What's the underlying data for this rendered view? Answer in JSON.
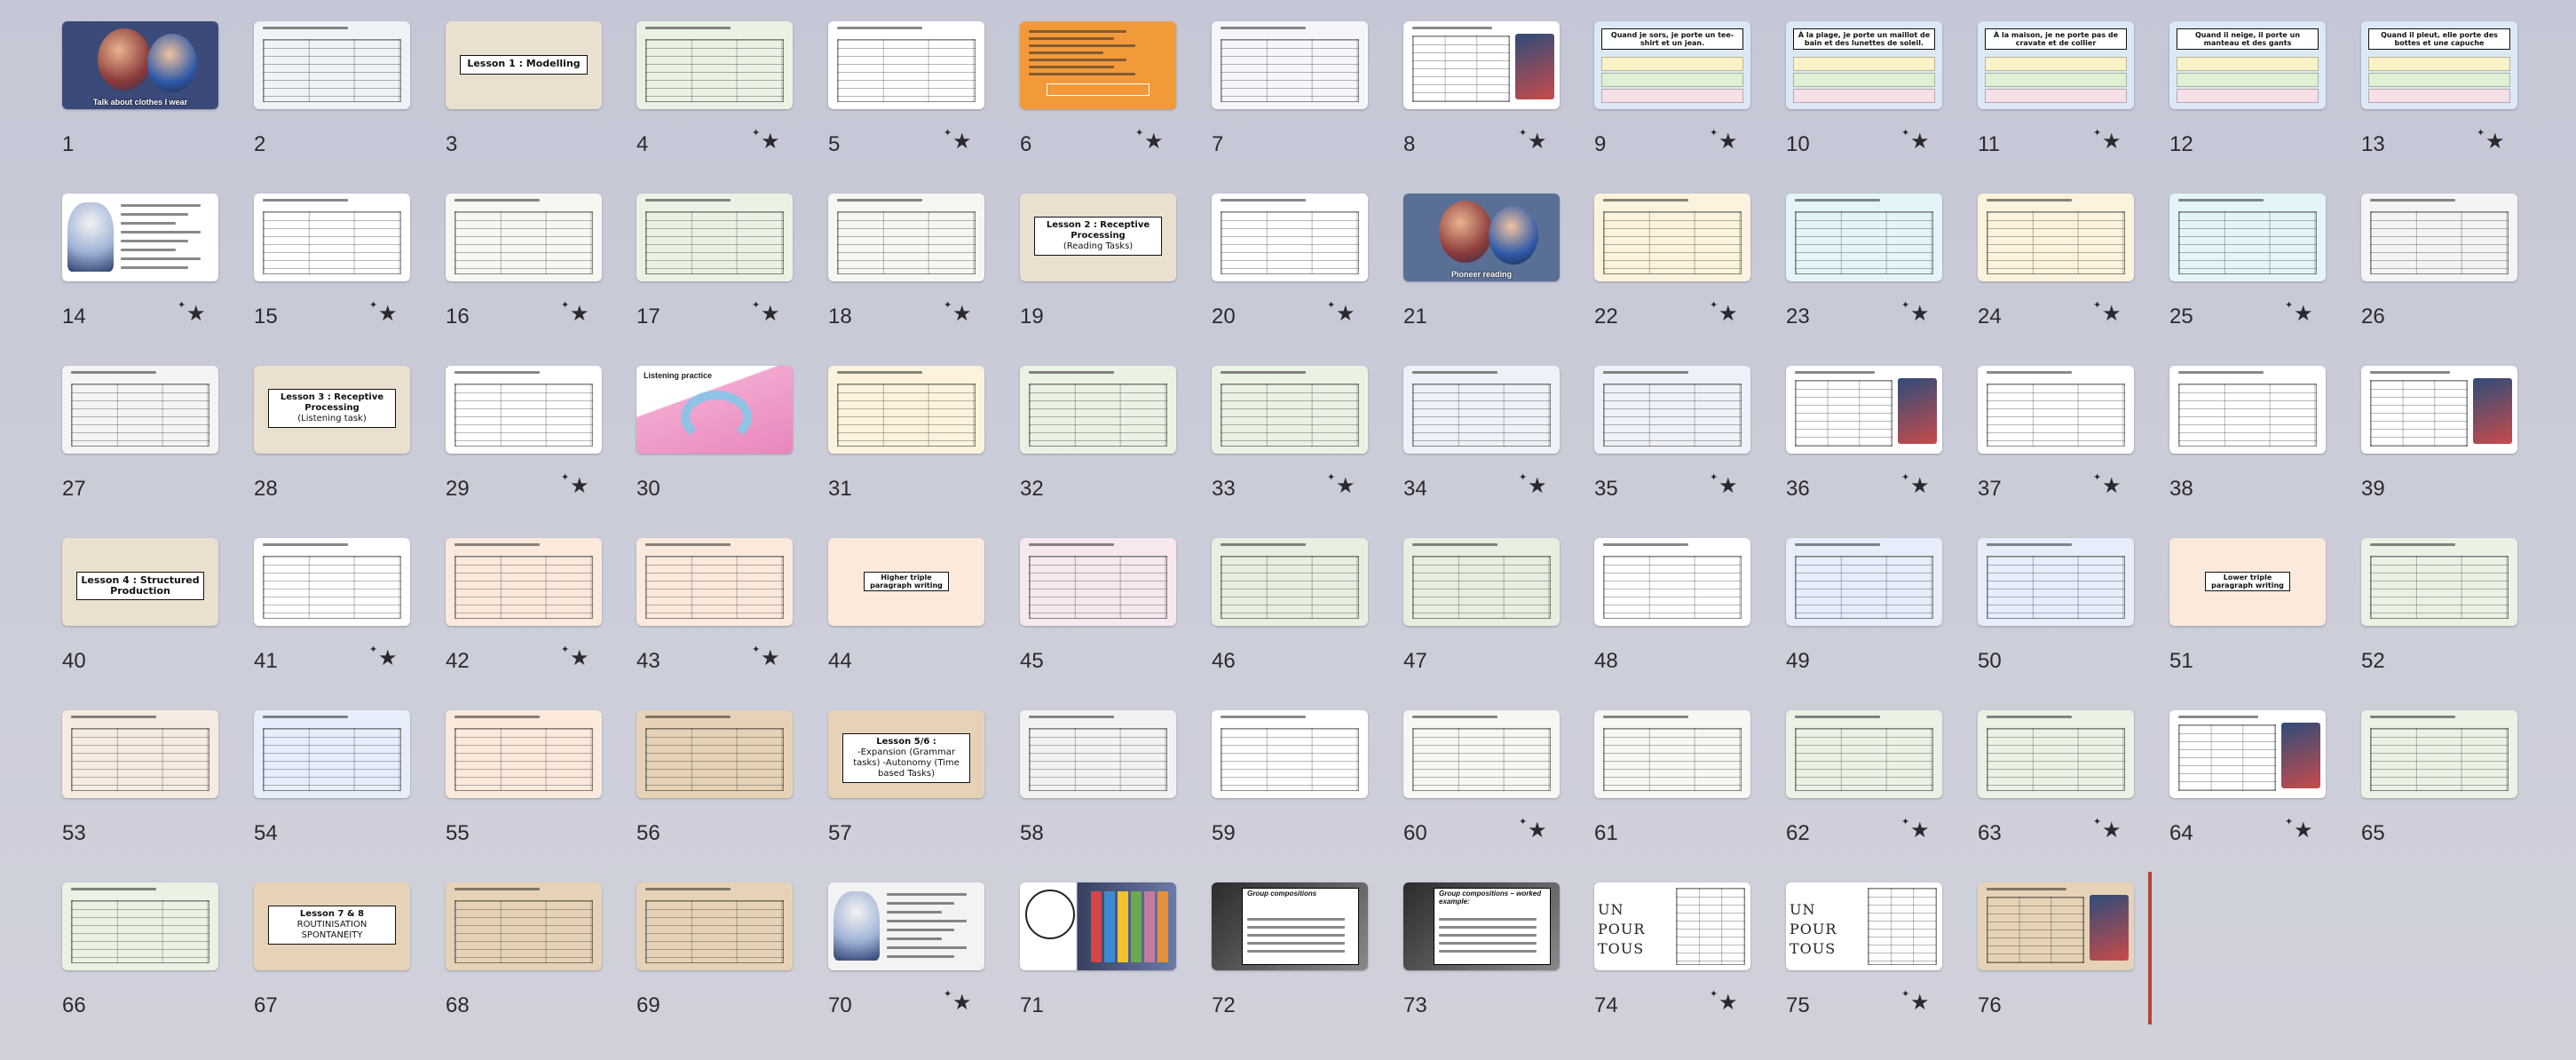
{
  "slides": [
    {
      "number": "1",
      "starred": false,
      "theme": "photo",
      "bg": "#3b4a78",
      "caption": "Talk about clothes I wear"
    },
    {
      "number": "2",
      "starred": false,
      "theme": "table",
      "bg": "#eef3f7"
    },
    {
      "number": "3",
      "starred": false,
      "theme": "section",
      "bg": "#e9e0cf",
      "title": "Lesson 1 : Modelling"
    },
    {
      "number": "4",
      "starred": true,
      "theme": "table",
      "bg": "#eaf2e4"
    },
    {
      "number": "5",
      "starred": true,
      "theme": "table",
      "bg": "#ffffff"
    },
    {
      "number": "6",
      "starred": true,
      "theme": "orange",
      "bg": "#f29a3a"
    },
    {
      "number": "7",
      "starred": false,
      "theme": "table",
      "bg": "#f4f6fb"
    },
    {
      "number": "8",
      "starred": true,
      "theme": "table-photo",
      "bg": "#ffffff"
    },
    {
      "number": "9",
      "starred": true,
      "theme": "sentence",
      "bg": "#dde8f7",
      "title": "Quand je sors, je porte un tee-shirt et un jean."
    },
    {
      "number": "10",
      "starred": true,
      "theme": "sentence",
      "bg": "#dde8f7",
      "title": "À la plage, je porte un maillot de bain et des lunettes de soleil."
    },
    {
      "number": "11",
      "starred": true,
      "theme": "sentence",
      "bg": "#dde8f7",
      "title": "À la maison, je ne porte pas de cravate et de collier"
    },
    {
      "number": "12",
      "starred": false,
      "theme": "sentence",
      "bg": "#dde8f7",
      "title": "Quand il neige, il porte un manteau et des gants"
    },
    {
      "number": "13",
      "starred": true,
      "theme": "sentence",
      "bg": "#dde8f7",
      "title": "Quand il pleut, elle porte des bottes et une capuche"
    },
    {
      "number": "14",
      "starred": true,
      "theme": "photo-list",
      "bg": "#ffffff"
    },
    {
      "number": "15",
      "starred": true,
      "theme": "table",
      "bg": "#ffffff"
    },
    {
      "number": "16",
      "starred": true,
      "theme": "table",
      "bg": "#f6f7f2"
    },
    {
      "number": "17",
      "starred": true,
      "theme": "table",
      "bg": "#eaf2e4"
    },
    {
      "number": "18",
      "starred": true,
      "theme": "table",
      "bg": "#f6f7f2"
    },
    {
      "number": "19",
      "starred": false,
      "theme": "section",
      "bg": "#e9e0cf",
      "title": "Lesson 2 : Receptive Processing",
      "subtitle": "(Reading Tasks)"
    },
    {
      "number": "20",
      "starred": true,
      "theme": "table",
      "bg": "#ffffff"
    },
    {
      "number": "21",
      "starred": false,
      "theme": "photo",
      "bg": "#5a6f96",
      "caption": "Pioneer reading"
    },
    {
      "number": "22",
      "starred": true,
      "theme": "table",
      "bg": "#fbf3dd"
    },
    {
      "number": "23",
      "starred": true,
      "theme": "table",
      "bg": "#e3f5f7"
    },
    {
      "number": "24",
      "starred": true,
      "theme": "table",
      "bg": "#fbf3dd"
    },
    {
      "number": "25",
      "starred": true,
      "theme": "table",
      "bg": "#e3f5f7"
    },
    {
      "number": "26",
      "starred": false,
      "theme": "table",
      "bg": "#f4f4f4"
    },
    {
      "number": "27",
      "starred": false,
      "theme": "table",
      "bg": "#f4f4f4"
    },
    {
      "number": "28",
      "starred": false,
      "theme": "section",
      "bg": "#e9e0cf",
      "title": "Lesson 3 : Receptive Processing",
      "subtitle": "(Listening task)"
    },
    {
      "number": "29",
      "starred": true,
      "theme": "table",
      "bg": "#ffffff"
    },
    {
      "number": "30",
      "starred": false,
      "theme": "headphones",
      "bg": "#f4c6de",
      "caption": "Listening practice"
    },
    {
      "number": "31",
      "starred": false,
      "theme": "table",
      "bg": "#fbf3dd"
    },
    {
      "number": "32",
      "starred": false,
      "theme": "table",
      "bg": "#eaf2e4"
    },
    {
      "number": "33",
      "starred": true,
      "theme": "table",
      "bg": "#eaf2e4"
    },
    {
      "number": "34",
      "starred": true,
      "theme": "table",
      "bg": "#eef1f7"
    },
    {
      "number": "35",
      "starred": true,
      "theme": "table",
      "bg": "#eef1f7"
    },
    {
      "number": "36",
      "starred": true,
      "theme": "table-photo",
      "bg": "#ffffff"
    },
    {
      "number": "37",
      "starred": true,
      "theme": "table",
      "bg": "#ffffff"
    },
    {
      "number": "38",
      "starred": false,
      "theme": "table",
      "bg": "#ffffff"
    },
    {
      "number": "39",
      "starred": false,
      "theme": "table-photo",
      "bg": "#ffffff"
    },
    {
      "number": "40",
      "starred": false,
      "theme": "section",
      "bg": "#e9e0cf",
      "title": "Lesson 4 : Structured Production"
    },
    {
      "number": "41",
      "starred": true,
      "theme": "table",
      "bg": "#ffffff"
    },
    {
      "number": "42",
      "starred": true,
      "theme": "table",
      "bg": "#fbe9dc"
    },
    {
      "number": "43",
      "starred": true,
      "theme": "table",
      "bg": "#fbe9dc"
    },
    {
      "number": "44",
      "starred": false,
      "theme": "plain",
      "bg": "#fbe9dc",
      "title": "Higher triple paragraph writing"
    },
    {
      "number": "45",
      "starred": false,
      "theme": "table",
      "bg": "#f7e8ef"
    },
    {
      "number": "46",
      "starred": false,
      "theme": "table",
      "bg": "#e7f0e0"
    },
    {
      "number": "47",
      "starred": false,
      "theme": "table",
      "bg": "#e7f0e0"
    },
    {
      "number": "48",
      "starred": false,
      "theme": "table",
      "bg": "#ffffff"
    },
    {
      "number": "49",
      "starred": false,
      "theme": "table",
      "bg": "#e6eefb"
    },
    {
      "number": "50",
      "starred": false,
      "theme": "table",
      "bg": "#e6eefb"
    },
    {
      "number": "51",
      "starred": false,
      "theme": "plain",
      "bg": "#fbe9dc",
      "title": "Lower triple paragraph writing"
    },
    {
      "number": "52",
      "starred": false,
      "theme": "table",
      "bg": "#eaf2e4"
    },
    {
      "number": "53",
      "starred": false,
      "theme": "table",
      "bg": "#f5ebe0"
    },
    {
      "number": "54",
      "starred": false,
      "theme": "table",
      "bg": "#e6eefb"
    },
    {
      "number": "55",
      "starred": false,
      "theme": "table",
      "bg": "#fbe9dc"
    },
    {
      "number": "56",
      "starred": false,
      "theme": "table",
      "bg": "#e6d3b7"
    },
    {
      "number": "57",
      "starred": false,
      "theme": "section",
      "bg": "#e6d3b7",
      "title": "Lesson 5/6 :",
      "subtitle": "-Expansion (Grammar tasks) -Autonomy (Time based Tasks)"
    },
    {
      "number": "58",
      "starred": false,
      "theme": "table",
      "bg": "#f2f2f2"
    },
    {
      "number": "59",
      "starred": false,
      "theme": "table",
      "bg": "#ffffff"
    },
    {
      "number": "60",
      "starred": true,
      "theme": "table",
      "bg": "#f6f7f2"
    },
    {
      "number": "61",
      "starred": false,
      "theme": "table",
      "bg": "#f6f7f2"
    },
    {
      "number": "62",
      "starred": true,
      "theme": "table",
      "bg": "#eaf2e4"
    },
    {
      "number": "63",
      "starred": true,
      "theme": "table",
      "bg": "#eaf2e4"
    },
    {
      "number": "64",
      "starred": true,
      "theme": "table-photo",
      "bg": "#ffffff"
    },
    {
      "number": "65",
      "starred": false,
      "theme": "table",
      "bg": "#eaf2e4"
    },
    {
      "number": "66",
      "starred": false,
      "theme": "table",
      "bg": "#eaf2e4"
    },
    {
      "number": "67",
      "starred": false,
      "theme": "section",
      "bg": "#e6d3b7",
      "title": "Lesson 7 & 8",
      "subtitle": "ROUTINISATION SPONTANEITY"
    },
    {
      "number": "68",
      "starred": false,
      "theme": "table",
      "bg": "#e6d3b7"
    },
    {
      "number": "69",
      "starred": false,
      "theme": "table",
      "bg": "#e6d3b7"
    },
    {
      "number": "70",
      "starred": true,
      "theme": "photo-list",
      "bg": "#f3f3f3"
    },
    {
      "number": "71",
      "starred": false,
      "theme": "bubble",
      "bg": "#3a4568"
    },
    {
      "number": "72",
      "starred": false,
      "theme": "dark",
      "bg": "#4a4a4a",
      "caption": "Group compositions"
    },
    {
      "number": "73",
      "starred": false,
      "theme": "dark",
      "bg": "#4a4a4a",
      "caption": "Group compositions – worked example:"
    },
    {
      "number": "74",
      "starred": true,
      "theme": "motto",
      "bg": "#ffffff",
      "caption": "UN POUR TOUS"
    },
    {
      "number": "75",
      "starred": true,
      "theme": "motto",
      "bg": "#ffffff",
      "caption": "UN POUR TOUS"
    },
    {
      "number": "76",
      "starred": false,
      "theme": "table-photo",
      "bg": "#e6d3b7"
    }
  ]
}
